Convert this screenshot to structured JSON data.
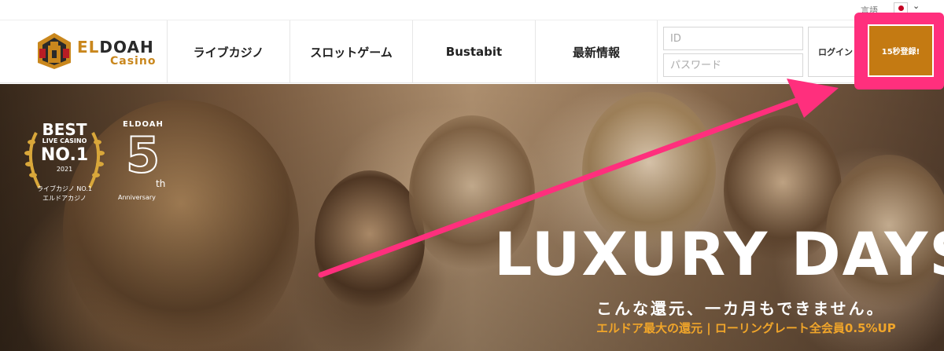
{
  "topbar": {
    "language_label": "言語",
    "language_flag_icon": "japan-flag-icon",
    "language_chevron": "chevron-down-icon"
  },
  "brand": {
    "name_prefix": "EL",
    "name_rest": "DOAH",
    "subtitle": "Casino"
  },
  "nav": {
    "items": [
      {
        "label": "ライブカジノ"
      },
      {
        "label": "スロットゲーム"
      },
      {
        "label": "Bustabit"
      },
      {
        "label": "最新情報"
      }
    ]
  },
  "login": {
    "id_placeholder": "ID",
    "password_placeholder": "パスワード",
    "login_label": "ログイン",
    "register_label": "15秒登録!"
  },
  "hero": {
    "badge": {
      "best": "BEST",
      "live_casino": "LIVE CASINO",
      "no1": "NO.1",
      "year": "2021",
      "line1": "ライブカジノ NO.1",
      "line2": "エルドアカジノ"
    },
    "anniversary": {
      "brand": "ELDOAH",
      "number": "5",
      "suffix": "th",
      "label": "Anniversary"
    },
    "title": "LUXURY DAYS",
    "subtitle": "こんな還元、一カ月もできません。",
    "tagline": "エルドア最大の還元 | ローリングレート全会員0.5%UP"
  },
  "colors": {
    "accent_gold": "#c9871d",
    "register_bg": "#c47a12",
    "highlight_pink": "#ff2f7d",
    "tagline_orange": "#f0a52a"
  }
}
